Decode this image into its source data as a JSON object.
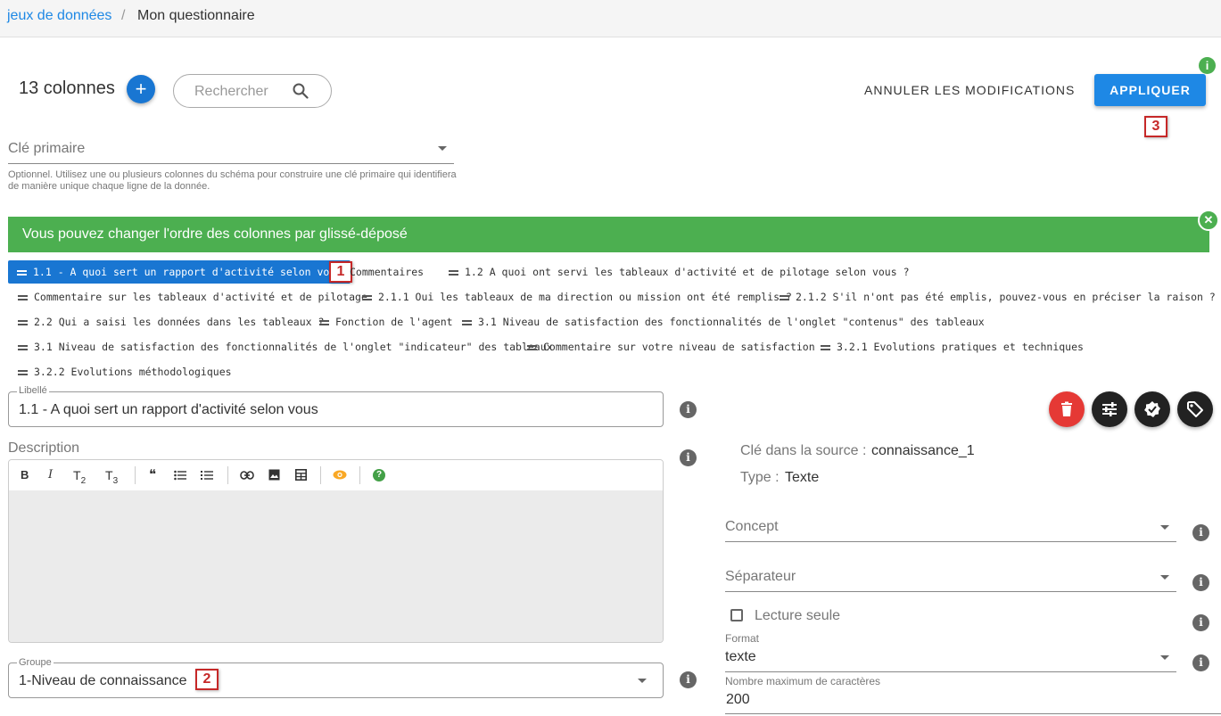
{
  "breadcrumb": {
    "link": "jeux de données",
    "separator": "/",
    "current": "Mon questionnaire"
  },
  "header": {
    "columns_count": "13 colonnes",
    "add_icon": "plus-icon",
    "search_placeholder": "Rechercher",
    "cancel_label": "ANNULER LES MODIFICATIONS",
    "apply_label": "APPLIQUER",
    "info_icon": "i"
  },
  "primary_key": {
    "label": "Clé primaire",
    "help": "Optionnel. Utilisez une ou plusieurs colonnes du schéma pour construire une clé primaire qui identifiera de manière unique chaque ligne de la donnée."
  },
  "banner": {
    "text": "Vous pouvez changer l'ordre des colonnes par glissé-déposé",
    "close": "✕"
  },
  "columns": [
    "1.1 - A quoi sert un rapport d'activité selon vous",
    "Commentaires",
    "1.2 A quoi ont servi les tableaux d'activité et de pilotage selon vous ?",
    "Commentaire sur les tableaux d'activité et de pilotage",
    "2.1.1 Oui les tableaux de ma direction ou mission ont été remplis ?",
    "2.1.2 S'il n'ont pas été emplis, pouvez-vous en préciser la raison ?",
    "2.2 Qui a saisi les données dans les tableaux ?",
    "Fonction de l'agent",
    "3.1 Niveau de satisfaction des fonctionnalités de l'onglet \"contenus\" des tableaux",
    "3.1 Niveau de satisfaction des fonctionnalités de l'onglet \"indicateur\" des tableaux",
    "Commentaire sur votre niveau de satisfaction",
    "3.2.1 Evolutions pratiques et techniques",
    "3.2.2 Evolutions méthodologiques"
  ],
  "badges": [
    "1",
    "2",
    "3"
  ],
  "editor": {
    "libelle_legend": "Libellé",
    "libelle_value": "1.1 - A quoi sert un rapport d'activité selon vous",
    "description_label": "Description",
    "toolbar": {
      "bold": "B",
      "italic": "I",
      "t2": "T",
      "t2sub": "2",
      "t3": "T",
      "t3sub": "3",
      "quote": "❝",
      "help": "?"
    },
    "groupe_legend": "Groupe",
    "groupe_value": "1-Niveau de connaissance"
  },
  "properties": {
    "source_key_label": "Clé dans la source :",
    "source_key_value": "connaissance_1",
    "type_label": "Type :",
    "type_value": "Texte",
    "concept_label": "Concept",
    "separator_label": "Séparateur",
    "readonly_label": "Lecture seule",
    "format_label": "Format",
    "format_value": "texte",
    "maxlen_label": "Nombre maximum de caractères",
    "maxlen_value": "200"
  },
  "colors": {
    "primary": "#1976d2",
    "success": "#4caf50",
    "danger": "#e53935",
    "badge": "#c62828"
  }
}
